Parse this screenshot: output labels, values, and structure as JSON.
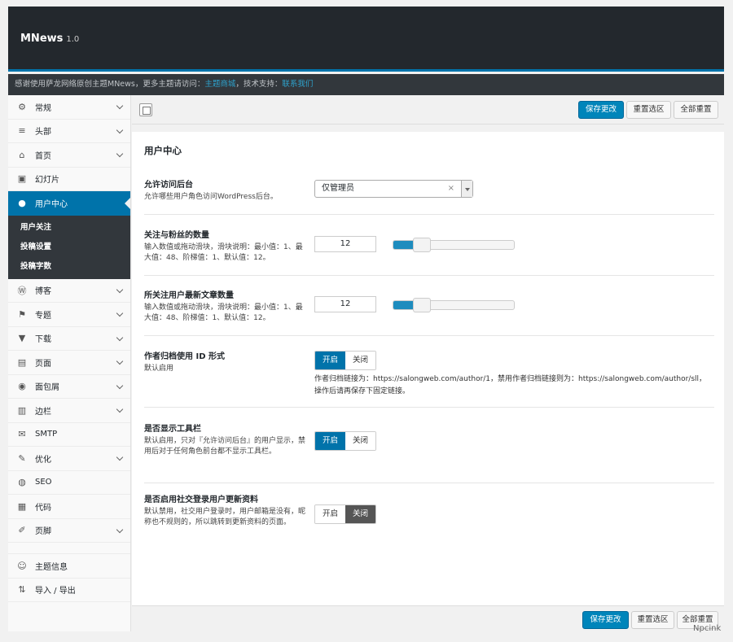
{
  "app": {
    "name": "MNews",
    "version": "1.0"
  },
  "notice": {
    "text": "感谢使用萨龙网络原创主题MNews，更多主题请访问：",
    "link1": "主题商城",
    "text2": "，技术支持：",
    "link2": "联系我们"
  },
  "sidebar": {
    "items": [
      {
        "label": "常规",
        "icon": "gear-icon"
      },
      {
        "label": "头部",
        "icon": "menu-icon"
      },
      {
        "label": "首页",
        "icon": "home-icon"
      },
      {
        "label": "幻灯片",
        "icon": "slides-icon"
      },
      {
        "label": "用户中心",
        "icon": "user-icon"
      },
      {
        "label": "博客",
        "icon": "wordpress-icon"
      },
      {
        "label": "专题",
        "icon": "flag-icon"
      },
      {
        "label": "下载",
        "icon": "download-icon"
      },
      {
        "label": "页面",
        "icon": "page-icon"
      },
      {
        "label": "面包屑",
        "icon": "location-icon"
      },
      {
        "label": "边栏",
        "icon": "sidebar-icon"
      },
      {
        "label": "SMTP",
        "icon": "mail-icon"
      },
      {
        "label": "优化",
        "icon": "wrench-icon"
      },
      {
        "label": "SEO",
        "icon": "globe-icon"
      },
      {
        "label": "代码",
        "icon": "code-icon"
      },
      {
        "label": "页脚",
        "icon": "pin-icon"
      }
    ],
    "sub_items": [
      "用户关注",
      "投稿设置",
      "投稿字数"
    ],
    "bottom_items": [
      {
        "label": "主题信息",
        "icon": "smile-icon"
      },
      {
        "label": "导入 / 导出",
        "icon": "import-icon"
      }
    ]
  },
  "toolbar": {
    "save": "保存更改",
    "reset_section": "重置选区",
    "reset_all": "全部重置"
  },
  "section_title": "用户中心",
  "fields": {
    "admin_access": {
      "title": "允许访问后台",
      "desc": "允许哪些用户角色访问WordPress后台。",
      "value": "仅管理员",
      "clear": "×"
    },
    "follow_count": {
      "title": "关注与粉丝的数量",
      "desc": "输入数值或拖动滑块，滑块说明：最小值：1、最大值：48、阶梯值：1、默认值：12。",
      "value": "12",
      "level_fraction": 0.234
    },
    "latest_posts": {
      "title": "所关注用户最新文章数量",
      "desc": "输入数值或拖动滑块，滑块说明：最小值：1、最大值：48、阶梯值：1、默认值：12。",
      "value": "12",
      "level_fraction": 0.234
    },
    "author_id": {
      "title": "作者归档使用 ID 形式",
      "desc": "默认启用",
      "on": "开启",
      "off": "关闭",
      "help": "作者归档链接为：https://salongweb.com/author/1，禁用作者归档链接则为：https://salongweb.com/author/sll，操作后请再保存下固定链接。"
    },
    "toolbar_show": {
      "title": "是否显示工具栏",
      "desc": "默认启用，只对『允许访问后台』的用户显示，禁用后对于任何角色前台都不显示工具栏。",
      "on": "开启",
      "off": "关闭"
    },
    "social_update": {
      "title": "是否启用社交登录用户更新资料",
      "desc": "默认禁用，社交用户登录时，用户邮箱是没有，昵称也不规则的，所以跳转到更新资料的页面。",
      "on": "开启",
      "off": "关闭"
    }
  },
  "watermark": "Npcink"
}
